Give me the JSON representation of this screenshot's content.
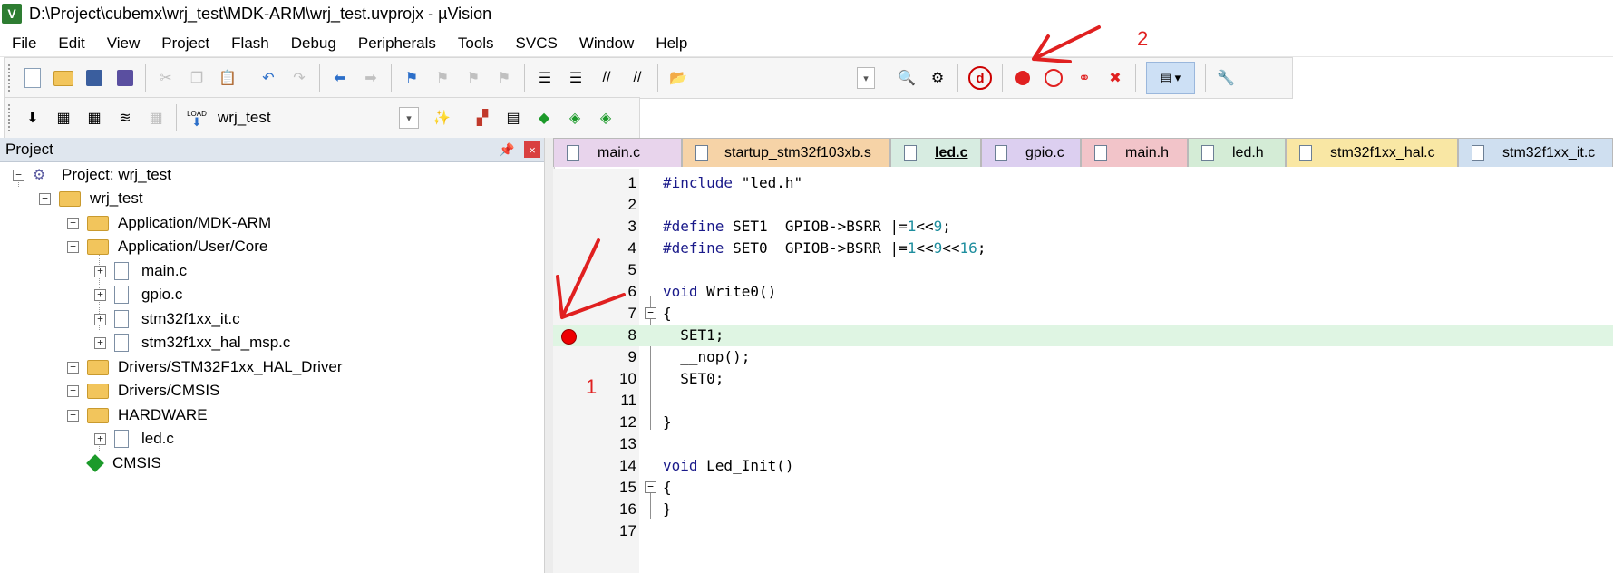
{
  "window": {
    "title": "D:\\Project\\cubemx\\wrj_test\\MDK-ARM\\wrj_test.uvprojx - µVision",
    "app_icon_letter": "V"
  },
  "menu": [
    "File",
    "Edit",
    "View",
    "Project",
    "Flash",
    "Debug",
    "Peripherals",
    "Tools",
    "SVCS",
    "Window",
    "Help"
  ],
  "toolbar2": {
    "load_label": "LOAD",
    "target_value": "wrj_test"
  },
  "project_panel": {
    "title": "Project",
    "pin_glyph": "📌",
    "close_glyph": "×",
    "tree": [
      {
        "label": "Project: wrj_test"
      },
      {
        "label": "wrj_test"
      },
      {
        "label": "Application/MDK-ARM"
      },
      {
        "label": "Application/User/Core"
      },
      {
        "label": "main.c"
      },
      {
        "label": "gpio.c"
      },
      {
        "label": "stm32f1xx_it.c"
      },
      {
        "label": "stm32f1xx_hal_msp.c"
      },
      {
        "label": "Drivers/STM32F1xx_HAL_Driver"
      },
      {
        "label": "Drivers/CMSIS"
      },
      {
        "label": "HARDWARE"
      },
      {
        "label": "led.c"
      },
      {
        "label": "CMSIS"
      }
    ]
  },
  "tabs": [
    {
      "label": "main.c",
      "color": "#e8d4ec"
    },
    {
      "label": "startup_stm32f103xb.s",
      "color": "#f6d3a7"
    },
    {
      "label": "led.c",
      "color": "#d7ece1"
    },
    {
      "label": "gpio.c",
      "color": "#dccff0"
    },
    {
      "label": "main.h",
      "color": "#f2c4c9"
    },
    {
      "label": "led.h",
      "color": "#d4ecd6"
    },
    {
      "label": "stm32f1xx_hal.c",
      "color": "#f9e7a4"
    },
    {
      "label": "stm32f1xx_it.c",
      "color": "#cfdff0"
    }
  ],
  "editor": {
    "line_numbers": [
      "1",
      "2",
      "3",
      "4",
      "5",
      "6",
      "7",
      "8",
      "9",
      "10",
      "11",
      "12",
      "13",
      "14",
      "15",
      "16",
      "17"
    ],
    "breakpoint_line": 8,
    "current_line": 8
  },
  "annotations": {
    "label_1": "1",
    "label_2": "2",
    "color": "#e02020"
  }
}
